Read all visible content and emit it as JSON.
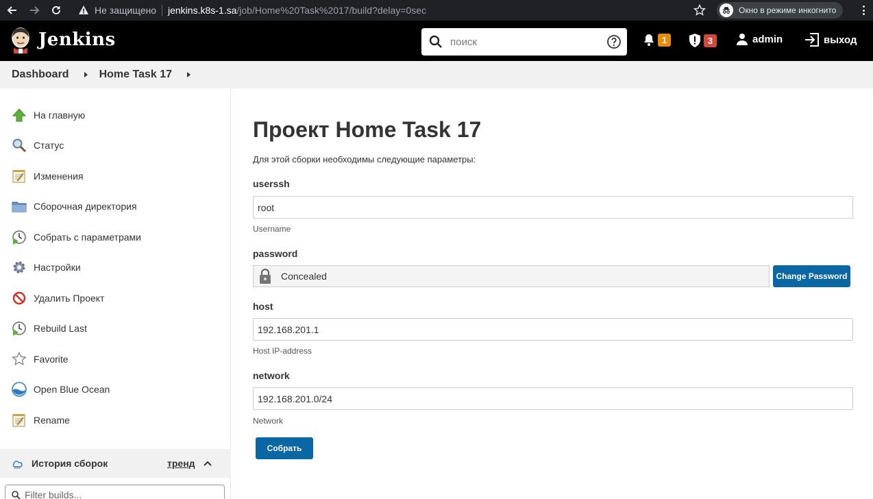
{
  "browser": {
    "not_secure": "Не защищено",
    "host": "jenkins.k8s-1.sa",
    "path": "/job/Home%20Task%2017/build?delay=0sec",
    "incognito_label": "Окно в режиме инкогнито"
  },
  "header": {
    "brand": "Jenkins",
    "search_placeholder": "поиск",
    "notifications_count": "1",
    "security_count": "3",
    "user": "admin",
    "logout": "выход"
  },
  "breadcrumb": {
    "items": [
      "Dashboard",
      "Home Task 17"
    ]
  },
  "sidebar": {
    "items": [
      {
        "label": "На главную",
        "icon": "up-arrow-icon"
      },
      {
        "label": "Статус",
        "icon": "magnifier-icon"
      },
      {
        "label": "Изменения",
        "icon": "notepad-icon"
      },
      {
        "label": "Сборочная директория",
        "icon": "folder-icon"
      },
      {
        "label": "Собрать с параметрами",
        "icon": "clock-play-icon"
      },
      {
        "label": "Настройки",
        "icon": "gear-icon"
      },
      {
        "label": "Удалить Проект",
        "icon": "no-entry-icon"
      },
      {
        "label": "Rebuild Last",
        "icon": "clock-play-icon"
      },
      {
        "label": "Favorite",
        "icon": "star-outline-icon"
      },
      {
        "label": "Open Blue Ocean",
        "icon": "blue-ocean-icon"
      },
      {
        "label": "Rename",
        "icon": "notepad-icon"
      }
    ],
    "history_title": "История сборок",
    "trend": "тренд",
    "filter_placeholder": "Filter builds..."
  },
  "main": {
    "title": "Проект Home Task 17",
    "intro": "Для этой сборки необходимы следующие параметры:",
    "params": {
      "userssh": {
        "label": "userssh",
        "value": "root",
        "desc": "Username"
      },
      "password": {
        "label": "password",
        "value": "Concealed",
        "button": "Change Password"
      },
      "host": {
        "label": "host",
        "value": "192.168.201.1",
        "desc": "Host IP-address"
      },
      "network": {
        "label": "network",
        "value": "192.168.201.0/24",
        "desc": "Network"
      }
    },
    "submit": "Собрать"
  },
  "colors": {
    "header_bg": "#000000",
    "breadcrumb_bg": "#f1f1f1",
    "primary_button": "#0b67a4",
    "notif_badge": "#e88a0a",
    "security_badge": "#d24939"
  }
}
